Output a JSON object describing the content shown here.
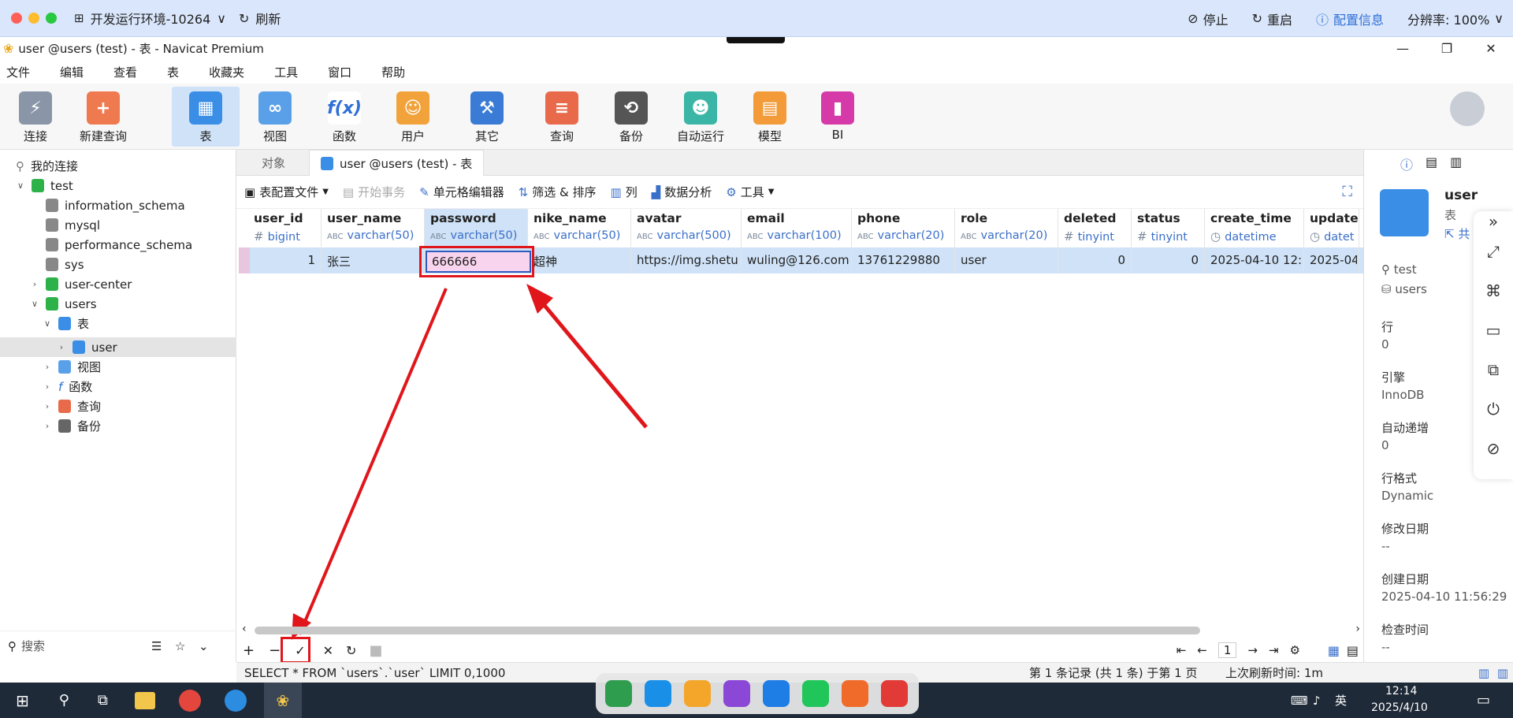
{
  "remote": {
    "env_title": "开发运行环境-10264",
    "refresh": "刷新",
    "stop": "停止",
    "restart": "重启",
    "config": "配置信息",
    "resolution": "分辨率: 100%"
  },
  "window": {
    "title": "user @users (test) - 表 - Navicat Premium"
  },
  "menu": [
    "文件",
    "编辑",
    "查看",
    "表",
    "收藏夹",
    "工具",
    "窗口",
    "帮助"
  ],
  "toolbar": {
    "items": [
      "连接",
      "新建查询",
      "表",
      "视图",
      "函数",
      "用户",
      "其它",
      "查询",
      "备份",
      "自动运行",
      "模型",
      "BI"
    ]
  },
  "tree": {
    "root": "我的连接",
    "connection": "test",
    "databases": [
      "information_schema",
      "mysql",
      "performance_schema",
      "sys",
      "user-center",
      "users"
    ],
    "users_children": [
      "表",
      "视图",
      "函数",
      "查询",
      "备份"
    ],
    "table_item": "user"
  },
  "search_label": "搜索",
  "tabs": {
    "objects": "对象",
    "current": "user @users (test) - 表"
  },
  "table_tools": [
    "表配置文件",
    "开始事务",
    "单元格编辑器",
    "筛选 & 排序",
    "列",
    "数据分析",
    "工具"
  ],
  "columns": [
    {
      "name": "user_id",
      "type": "bigint",
      "sym": "#"
    },
    {
      "name": "user_name",
      "type": "varchar(50)",
      "sym": "ABC"
    },
    {
      "name": "password",
      "type": "varchar(50)",
      "sym": "ABC"
    },
    {
      "name": "nike_name",
      "type": "varchar(50)",
      "sym": "ABC"
    },
    {
      "name": "avatar",
      "type": "varchar(500)",
      "sym": "ABC"
    },
    {
      "name": "email",
      "type": "varchar(100)",
      "sym": "ABC"
    },
    {
      "name": "phone",
      "type": "varchar(20)",
      "sym": "ABC"
    },
    {
      "name": "role",
      "type": "varchar(20)",
      "sym": "ABC"
    },
    {
      "name": "deleted",
      "type": "tinyint",
      "sym": "#"
    },
    {
      "name": "status",
      "type": "tinyint",
      "sym": "#"
    },
    {
      "name": "create_time",
      "type": "datetime",
      "sym": "◷"
    },
    {
      "name": "update",
      "type": "datet",
      "sym": "◷"
    }
  ],
  "row": {
    "user_id": "1",
    "user_name": "张三",
    "password": "666666",
    "nike_name": "超神",
    "avatar": "https://img.shetu(",
    "email": "wuling@126.com",
    "phone": "13761229880",
    "role": "user",
    "deleted": "0",
    "status": "0",
    "create_time": "2025-04-10 12:",
    "update": "2025-04-"
  },
  "statusbar": {
    "sql": "SELECT * FROM `users`.`user` LIMIT 0,1000",
    "records": "第 1 条记录 (共 1 条) 于第 1 页",
    "refresh": "上次刷新时间: 1m"
  },
  "pager": {
    "page": "1"
  },
  "right": {
    "name": "user",
    "kind": "表",
    "share": "共",
    "conn": "test",
    "db": "users",
    "rows_label": "行",
    "rows_val": "0",
    "engine_label": "引擎",
    "engine_val": "InnoDB",
    "autoinc_label": "自动递增",
    "autoinc_val": "0",
    "rowfmt_label": "行格式",
    "rowfmt_val": "Dynamic",
    "modified_label": "修改日期",
    "modified_val": "--",
    "created_label": "创建日期",
    "created_val": "2025-04-10 11:56:29",
    "check_label": "检查时间",
    "check_val": "--"
  },
  "taskbar": {
    "ime": "英",
    "time": "12:14",
    "date": "2025/4/10"
  },
  "colors": {
    "accent": "#2f5bbf",
    "annotation_red": "#e0161b",
    "selection": "#cfe2f7",
    "edit_cell": "#f8d4ee"
  }
}
